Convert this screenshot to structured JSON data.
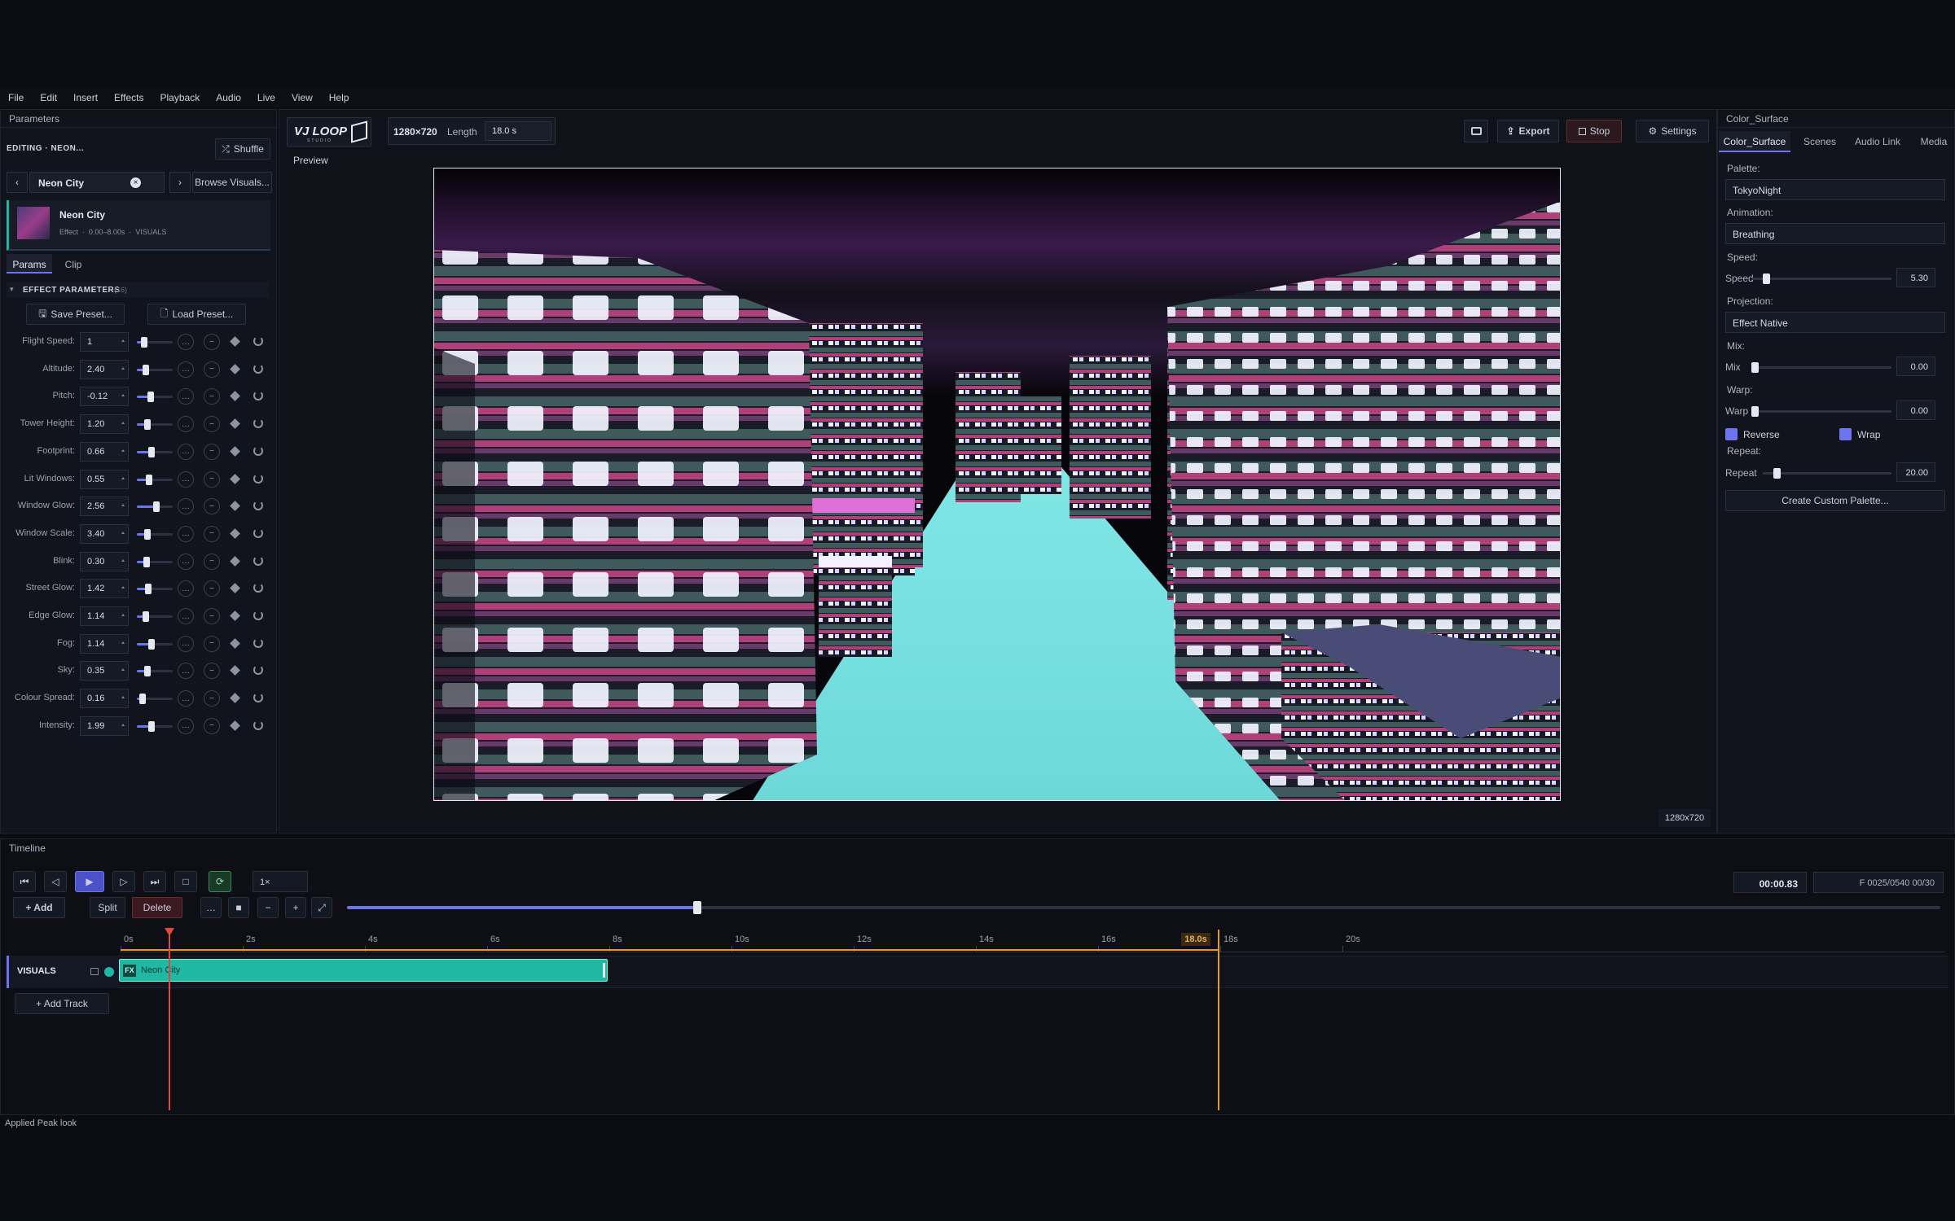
{
  "menu": [
    "File",
    "Edit",
    "Insert",
    "Effects",
    "Playback",
    "Audio",
    "Live",
    "View",
    "Help"
  ],
  "left": {
    "title": "Parameters",
    "editing": "EDITING · NEON...",
    "shuffle": "Shuffle",
    "selector": "Neon City",
    "browse": "Browse Visuals...",
    "clip_name": "Neon City",
    "clip_type": "Effect",
    "clip_range": "0.00–8.00s",
    "clip_track": "VISUALS",
    "tab_params": "Params",
    "tab_clip": "Clip",
    "section": "EFFECT PARAMETERS",
    "section_count": "(16)",
    "save": "Save Preset...",
    "load": "Load Preset...",
    "params": [
      {
        "label": "Flight Speed:",
        "value": "1",
        "frac": 0.2
      },
      {
        "label": "Altitude:",
        "value": "2.40",
        "frac": 0.25
      },
      {
        "label": "Pitch:",
        "value": "-0.12",
        "frac": 0.38
      },
      {
        "label": "Tower Height:",
        "value": "1.20",
        "frac": 0.3
      },
      {
        "label": "Footprint:",
        "value": "0.66",
        "frac": 0.42
      },
      {
        "label": "Lit Windows:",
        "value": "0.55",
        "frac": 0.35
      },
      {
        "label": "Window Glow:",
        "value": "2.56",
        "frac": 0.55
      },
      {
        "label": "Window Scale:",
        "value": "3.40",
        "frac": 0.3
      },
      {
        "label": "Blink:",
        "value": "0.30",
        "frac": 0.28
      },
      {
        "label": "Street Glow:",
        "value": "1.42",
        "frac": 0.32
      },
      {
        "label": "Edge Glow:",
        "value": "1.14",
        "frac": 0.26
      },
      {
        "label": "Fog:",
        "value": "1.14",
        "frac": 0.4
      },
      {
        "label": "Sky:",
        "value": "0.35",
        "frac": 0.3
      },
      {
        "label": "Colour Spread:",
        "value": "0.16",
        "frac": 0.15
      },
      {
        "label": "Intensity:",
        "value": "1.99",
        "frac": 0.4
      }
    ]
  },
  "top": {
    "logo": "VJ LOOP",
    "logo_sub": "STUDIO",
    "resolution": "1280×720",
    "length_label": "Length",
    "length_value": "18.0 s",
    "export": "Export",
    "stop": "Stop",
    "settings": "Settings",
    "preview_label": "Preview",
    "res_badge": "1280x720"
  },
  "right": {
    "title": "Color_Surface",
    "tabs": [
      "Color_Surface",
      "Scenes",
      "Audio Link",
      "Media"
    ],
    "palette_label": "Palette:",
    "palette": "TokyoNight",
    "animation_label": "Animation:",
    "animation": "Breathing",
    "speed_label": "Speed:",
    "speed_name": "Speed",
    "speed_value": "5.30",
    "speed_frac": 0.08,
    "projection_label": "Projection:",
    "projection": "Effect Native",
    "mix_label": "Mix:",
    "mix_name": "Mix",
    "mix_value": "0.00",
    "warp_label": "Warp:",
    "warp_name": "Warp",
    "warp_value": "0.00",
    "reverse": "Reverse",
    "wrap": "Wrap",
    "repeat_label": "Repeat:",
    "repeat_name": "Repeat",
    "repeat_value": "20.00",
    "repeat_frac": 0.08,
    "create": "Create Custom Palette..."
  },
  "timeline": {
    "title": "Timeline",
    "rate": "1×",
    "add": "+ Add",
    "split": "Split",
    "delete": "Delete",
    "time": "00:00.83",
    "frame": "F 0025/0540  00/30",
    "zoom_frac": 0.22,
    "ticks": [
      "0s",
      "2s",
      "4s",
      "6s",
      "8s",
      "10s",
      "12s",
      "14s",
      "16s",
      "18s",
      "20s"
    ],
    "end_marker": "18.0s",
    "track_name": "VISUALS",
    "clip_fx": "FX",
    "clip_name": "Neon City",
    "add_track": "+ Add Track"
  },
  "status": "Applied Peak look",
  "colors": {
    "accent": "#6d74f0",
    "clip": "#1fb8a3",
    "playhead": "#e04a3c",
    "endmarker": "#e59a2a"
  }
}
